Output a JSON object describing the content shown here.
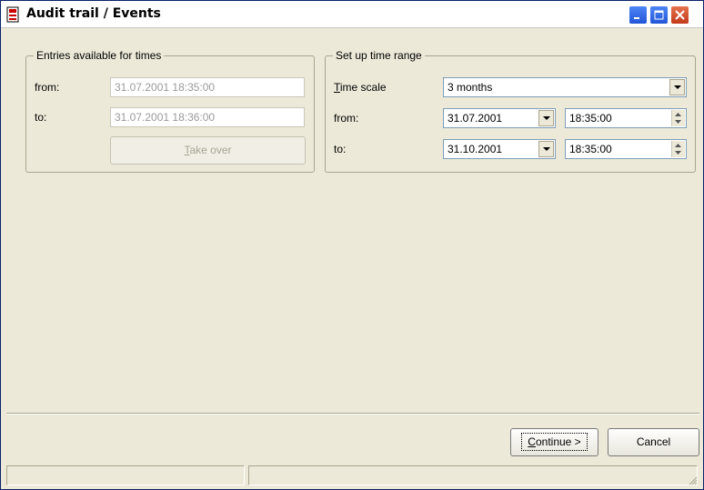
{
  "window": {
    "title": "Audit trail / Events",
    "icon": "document-red-icon"
  },
  "entries_group": {
    "legend": "Entries available for times",
    "from_label": "from:",
    "from_value": "31.07.2001  18:35:00",
    "to_label": "to:",
    "to_value": "31.07.2001  18:36:00",
    "take_over_label_prefix": "",
    "take_over_label_accel": "T",
    "take_over_label_rest": "ake over"
  },
  "range_group": {
    "legend": "Set up time range",
    "time_scale_label_accel": "T",
    "time_scale_label_rest": "ime scale",
    "time_scale_value": "3 months",
    "from_label": "from:",
    "from_date": "31.07.2001",
    "from_time": "18:35:00",
    "to_label": "to:",
    "to_date": "31.10.2001",
    "to_time": "18:35:00"
  },
  "buttons": {
    "continue_accel": "C",
    "continue_rest": "ontinue >",
    "cancel": "Cancel"
  },
  "colors": {
    "face": "#ece9d8",
    "field_border": "#7f9db9",
    "close": "#c2391a",
    "titlebar_button": "#2155d8"
  }
}
